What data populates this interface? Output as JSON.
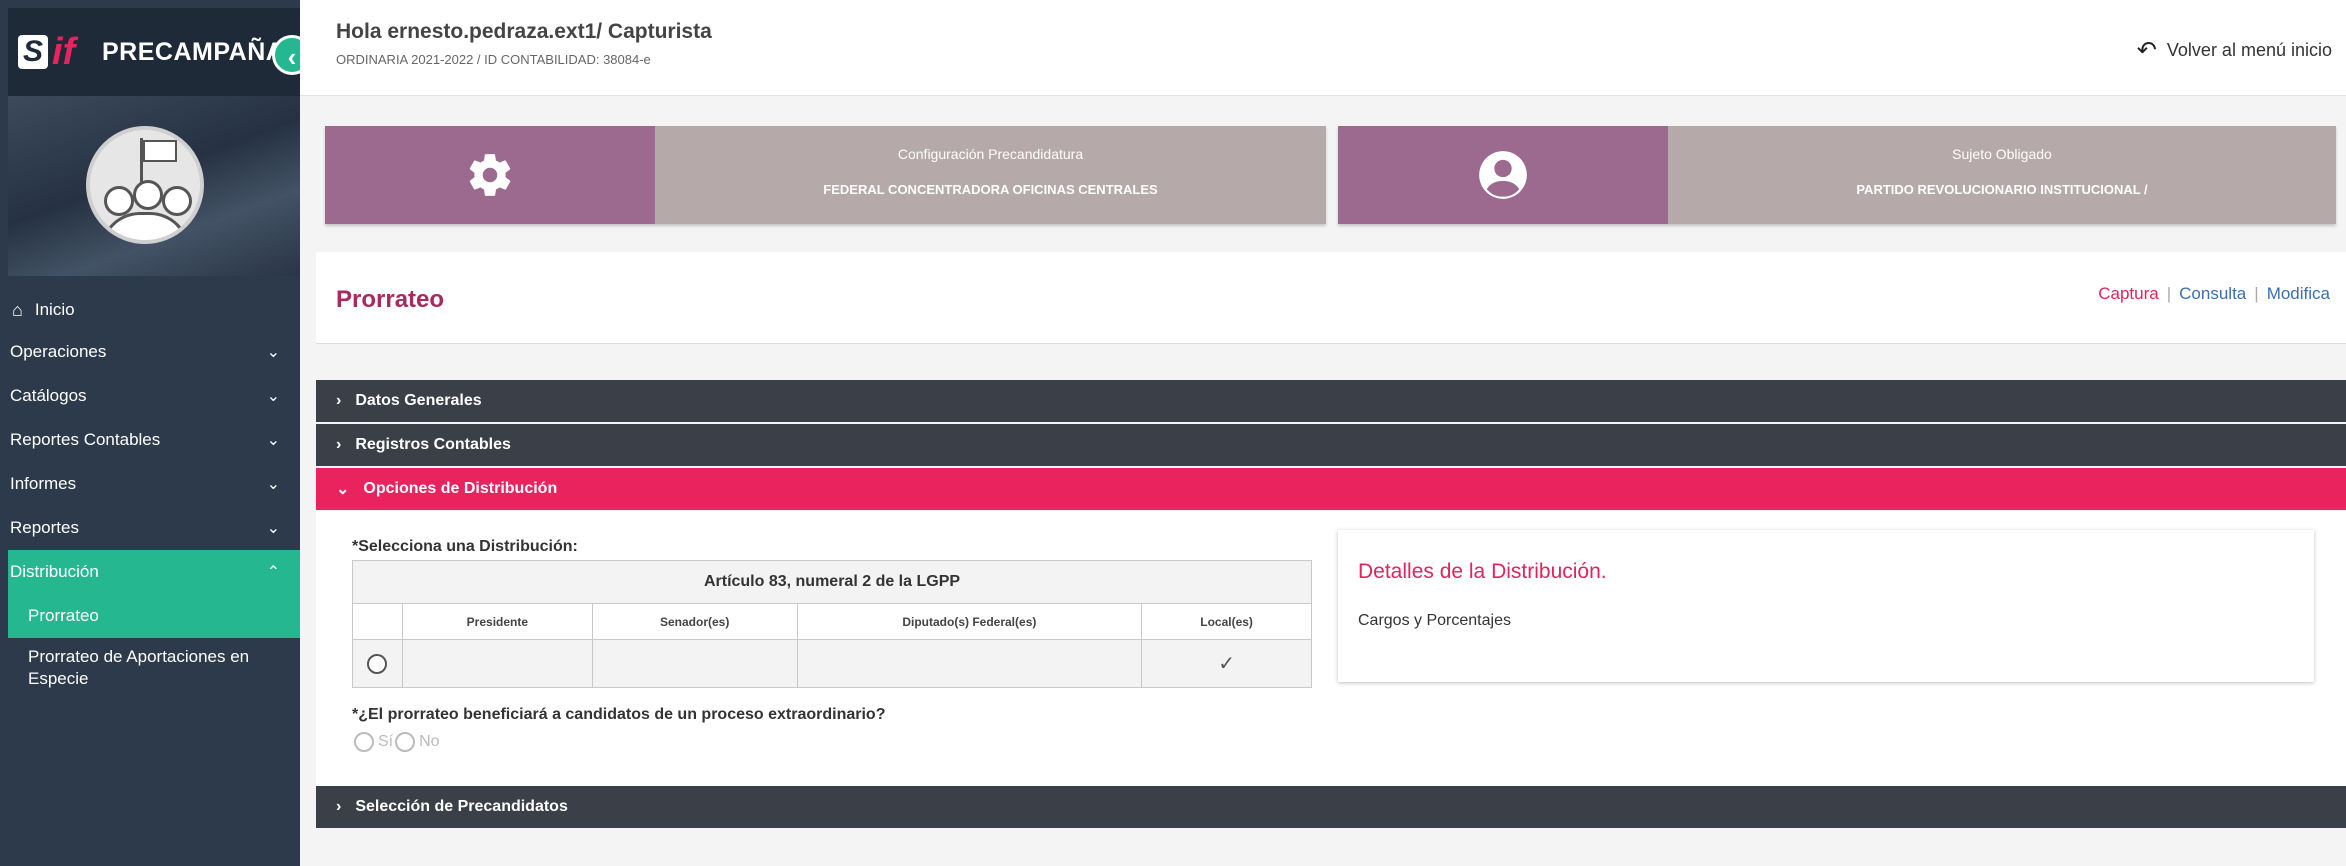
{
  "app": {
    "brand": "PRECAMPAÑA",
    "logo_s": "S",
    "logo_if": "if"
  },
  "header": {
    "greeting": "Hola ernesto.pedraza.ext1/ Capturista",
    "subline": "ORDINARIA 2021-2022 / ID CONTABILIDAD: 38084-e",
    "back_label": "Volver al menú inicio"
  },
  "sidebar": {
    "home_label": "Inicio",
    "items": [
      {
        "label": "Operaciones"
      },
      {
        "label": "Catálogos"
      },
      {
        "label": "Reportes Contables"
      },
      {
        "label": "Informes"
      },
      {
        "label": "Reportes"
      },
      {
        "label": "Distribución"
      }
    ],
    "sub_items": [
      {
        "label": "Prorrateo"
      },
      {
        "label": "Prorrateo de Aportaciones en Especie"
      }
    ]
  },
  "cards": [
    {
      "title": "Configuración Precandidatura",
      "value": "FEDERAL CONCENTRADORA OFICINAS CENTRALES",
      "icon": "gear-icon"
    },
    {
      "title": "Sujeto Obligado",
      "value": "PARTIDO REVOLUCIONARIO INSTITUCIONAL /",
      "icon": "user-circle-icon"
    }
  ],
  "page": {
    "title": "Prorrateo",
    "links": {
      "captura": "Captura",
      "consulta": "Consulta",
      "modifica": "Modifica"
    }
  },
  "accordion": {
    "datos_generales": "Datos Generales",
    "registros_contables": "Registros Contables",
    "opciones_distribucion": "Opciones de Distribución",
    "seleccion_precandidatos": "Selección de Precandidatos"
  },
  "distribution": {
    "select_label": "*Selecciona una Distribución:",
    "table_caption": "Artículo 83, numeral 2 de la LGPP",
    "columns": [
      "Presidente",
      "Senador(es)",
      "Diputado(s) Federal(es)",
      "Local(es)"
    ],
    "row_local_mark": "✓",
    "question": "*¿El prorrateo beneficiará a candidatos de un proceso extraordinario?",
    "option_yes": "Sí",
    "option_no": "No"
  },
  "details": {
    "title": "Detalles de la Distribución.",
    "subtitle": "Cargos y Porcentajes"
  },
  "colors": {
    "accent_pink": "#e8235e",
    "accent_green": "#25b890",
    "sidebar_bg": "#2d3a4b",
    "card_icon_bg": "#9c6a8e",
    "card_bg": "#b5a9a9"
  }
}
